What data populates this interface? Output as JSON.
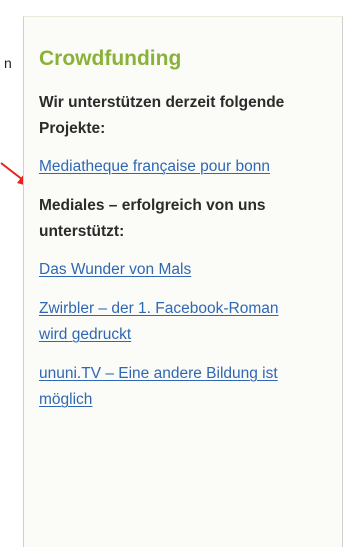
{
  "page": {
    "left_fragment": "n"
  },
  "colors": {
    "title": "#8ab13a",
    "link": "#2f67b5",
    "arrow": "#e8231f",
    "box_background": "#fbfcf7"
  },
  "sidebar": {
    "title": "Crowdfunding",
    "current_heading": "Wir unterstützen derzeit folgende Projekte:",
    "current_projects": [
      {
        "label": "Mediatheque française pour bonn"
      }
    ],
    "past_heading": "Mediales – erfolgreich von uns unterstützt:",
    "past_projects": [
      {
        "label": "Das Wunder von Mals"
      },
      {
        "label": "Zwirbler – der 1. Facebook-Roman wird gedruckt"
      },
      {
        "label": "ununi.TV – Eine andere Bildung ist möglich"
      }
    ]
  }
}
